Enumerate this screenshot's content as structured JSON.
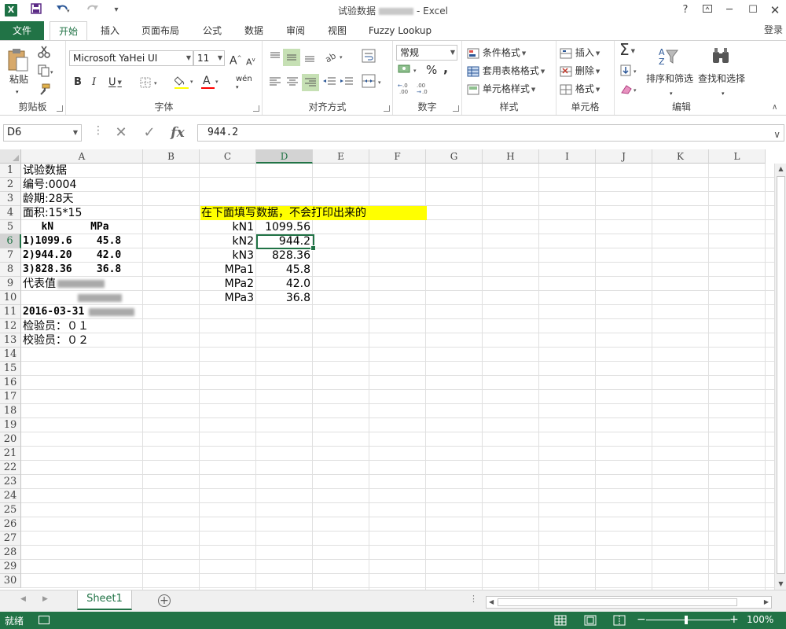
{
  "window": {
    "title_prefix": "试验数据",
    "title_suffix": "- Excel",
    "help": "?",
    "controls": [
      "restore",
      "minimize",
      "maximize",
      "close"
    ]
  },
  "quick_access": {
    "save": "save-icon",
    "undo": "undo-icon",
    "redo": "redo-icon",
    "customize": "customize-icon"
  },
  "tabs": [
    "文件",
    "开始",
    "插入",
    "页面布局",
    "公式",
    "数据",
    "审阅",
    "视图",
    "Fuzzy Lookup"
  ],
  "active_tab": "开始",
  "login": "登录",
  "ribbon": {
    "clipboard": {
      "paste": "粘贴",
      "label": "剪贴板"
    },
    "font": {
      "name": "Microsoft YaHei UI",
      "size": "11",
      "bold": "B",
      "italic": "I",
      "underline": "U",
      "grow": "A",
      "shrink": "A",
      "phonetic": "wén",
      "fill_color": "#ffff00",
      "font_color": "#ff0000",
      "label": "字体"
    },
    "alignment": {
      "label": "对齐方式"
    },
    "number": {
      "format": "常规",
      "percent": "%",
      "comma": ",",
      "label": "数字"
    },
    "styles": {
      "conditional": "条件格式",
      "table": "套用表格格式",
      "cell": "单元格样式",
      "label": "样式"
    },
    "cells": {
      "insert": "插入",
      "delete": "删除",
      "format": "格式",
      "label": "单元格"
    },
    "editing": {
      "sum": "Σ",
      "sort": "排序和筛选",
      "find": "查找和选择",
      "label": "编辑"
    }
  },
  "formula_bar": {
    "name_box": "D6",
    "cancel": "✕",
    "enter": "✓",
    "fx": "fx",
    "value": "944.2"
  },
  "columns": [
    "A",
    "B",
    "C",
    "D",
    "E",
    "F",
    "G",
    "H",
    "I",
    "J",
    "K",
    "L"
  ],
  "selected_column": "D",
  "rows": [
    "1",
    "2",
    "3",
    "4",
    "5",
    "6",
    "7",
    "8",
    "9",
    "10",
    "11",
    "12",
    "13",
    "14",
    "15",
    "16",
    "17",
    "18",
    "19",
    "20",
    "21",
    "22",
    "23",
    "24",
    "25",
    "26",
    "27",
    "28",
    "29",
    "30"
  ],
  "selected_row": "6",
  "cells": {
    "A1": "试验数据",
    "A2": "编号:0004",
    "A3": "龄期:28天",
    "A4": "面积:15*15",
    "A5": "   kN      MPa",
    "A6": "1)1099.6    45.8",
    "A7": "2)944.20    42.0",
    "A8": "3)828.36    36.8",
    "A9": "代表值",
    "A11": "2016-03-31",
    "A12": "检验员：０１",
    "A13": "校验员：０２",
    "C4": "在下面填写数据，不会打印出来的",
    "C5": "kN1",
    "D5": "1099.56",
    "C6": "kN2",
    "D6": "944.2",
    "C7": "kN3",
    "D7": "828.36",
    "C8": "MPa1",
    "D8": "45.8",
    "C9": "MPa2",
    "D9": "42.0",
    "C10": "MPa3",
    "D10": "36.8"
  },
  "selected_cell": "D6",
  "highlight_color": "#ffff00",
  "sheet_tabs": [
    "Sheet1"
  ],
  "active_sheet": "Sheet1",
  "status": {
    "ready": "就绪",
    "zoom": "100%"
  },
  "accent_color": "#217346"
}
